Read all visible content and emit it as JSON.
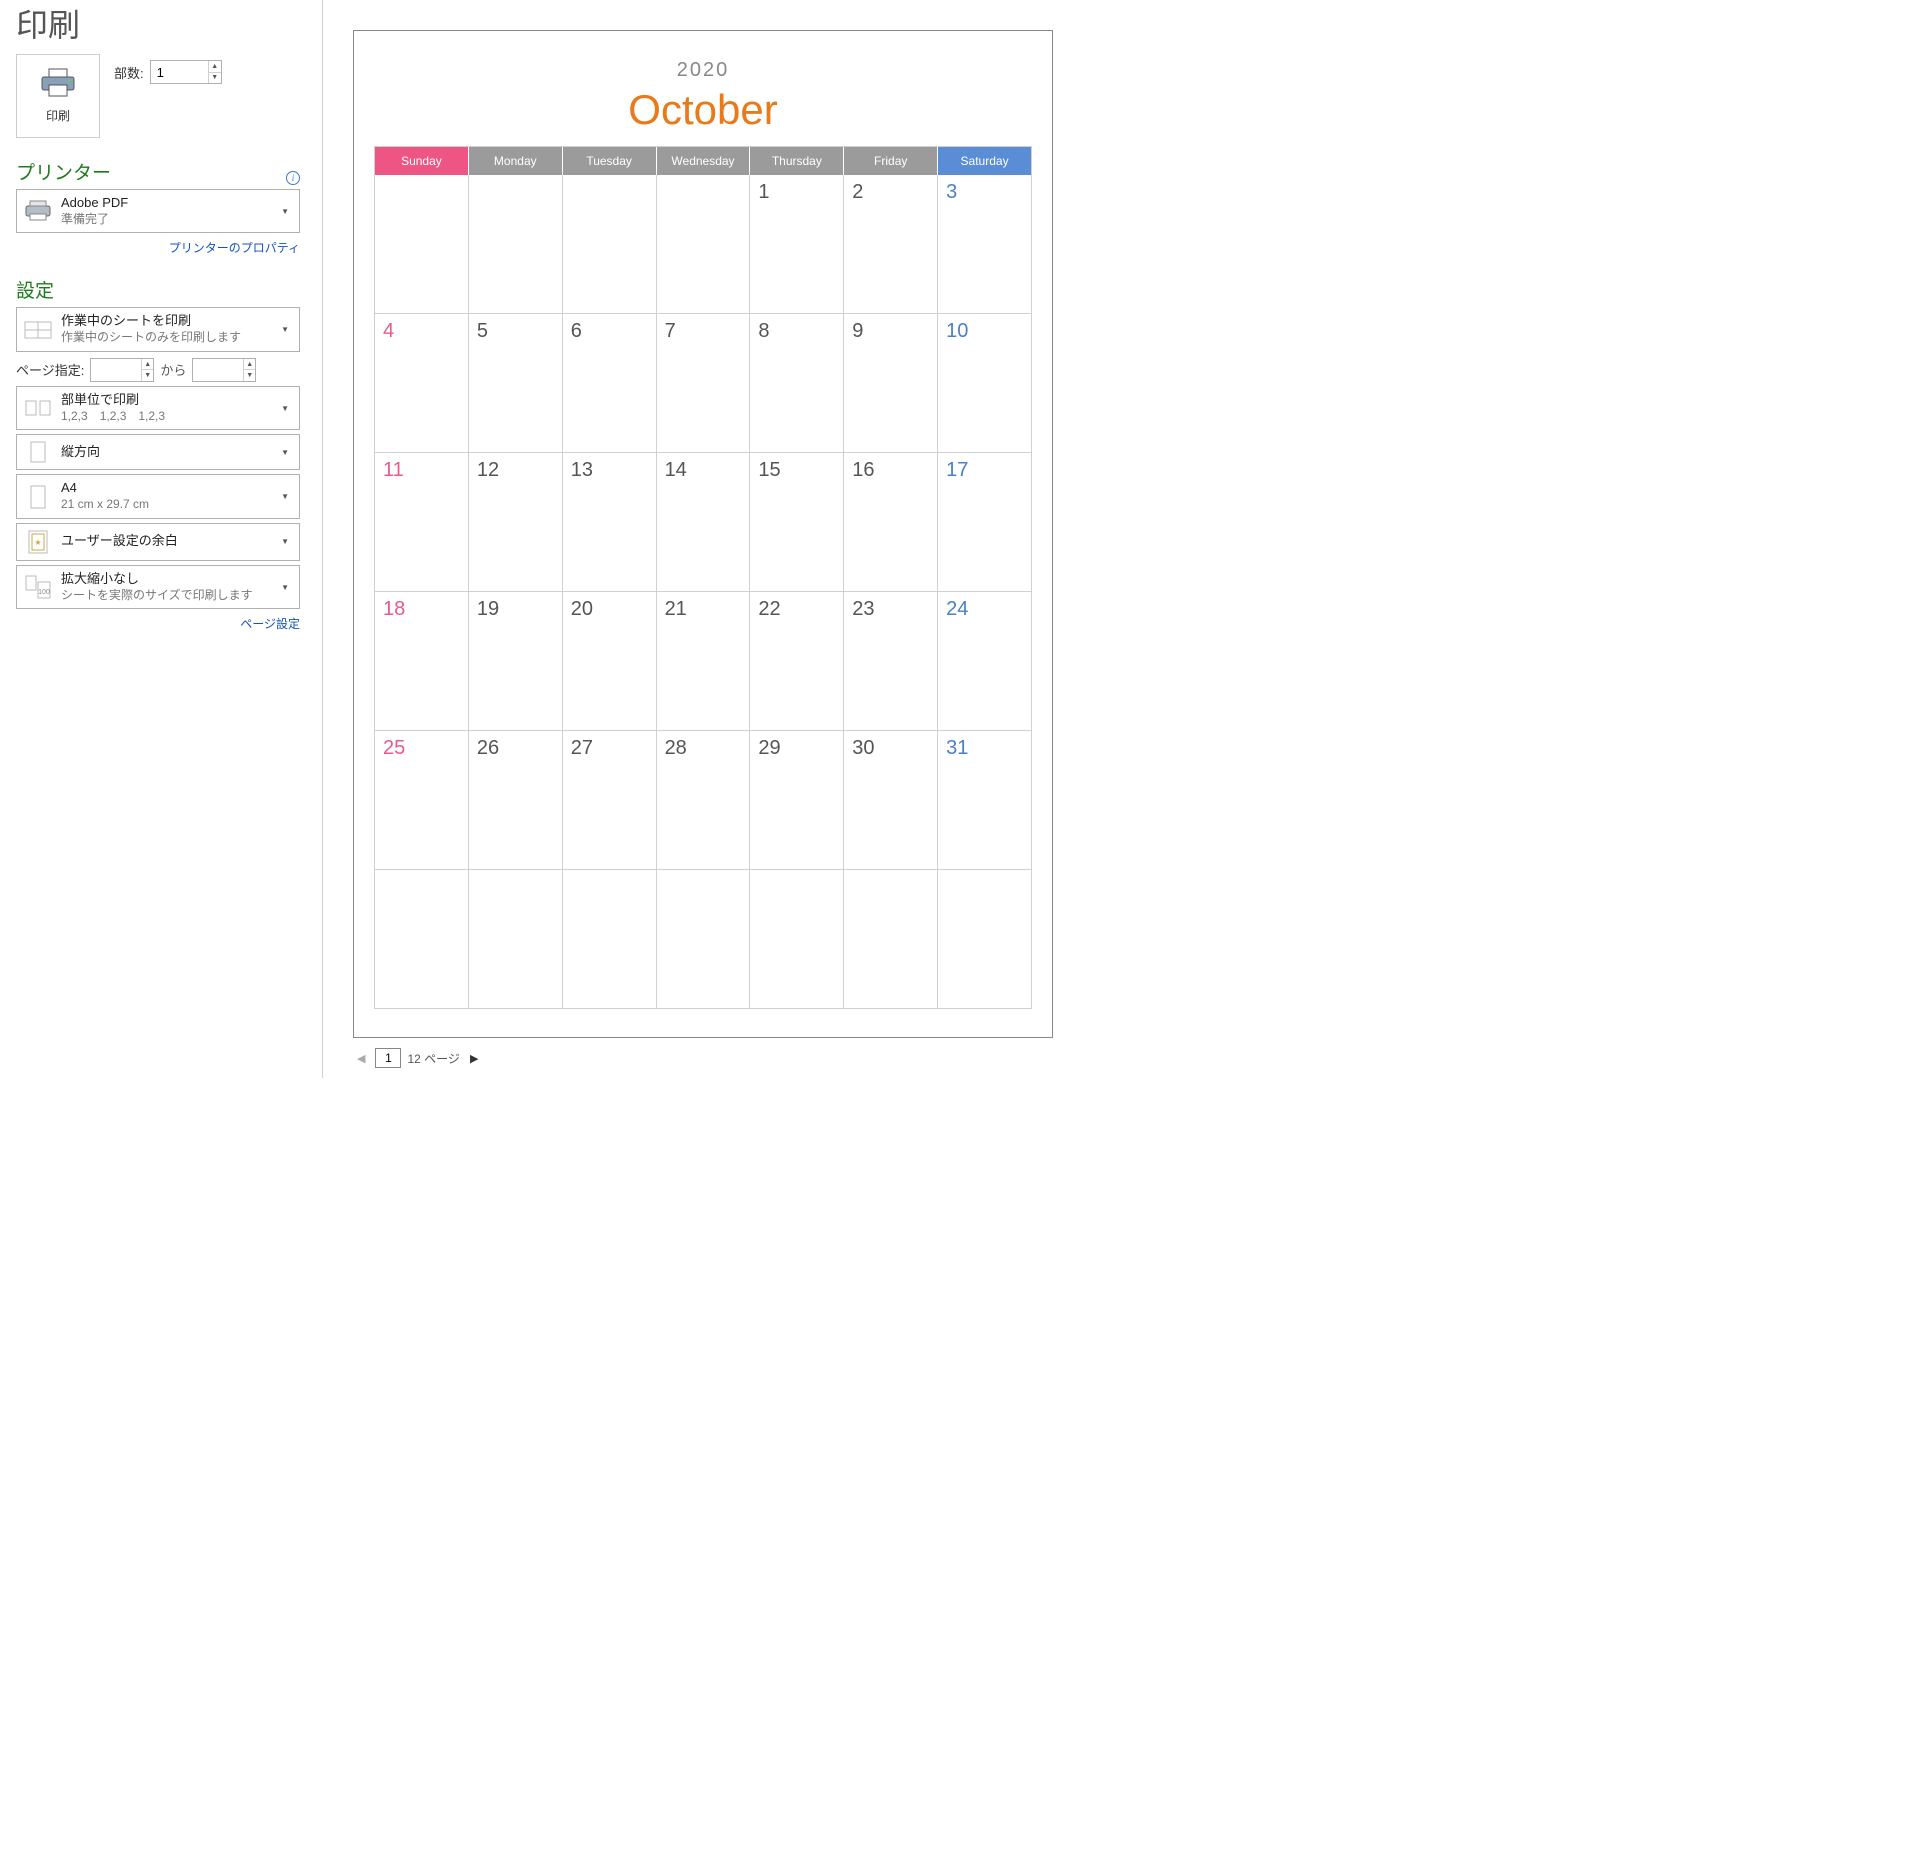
{
  "title": "印刷",
  "print_button_label": "印刷",
  "copies": {
    "label": "部数:",
    "value": "1"
  },
  "printer_section": {
    "title": "プリンター",
    "selected": {
      "name": "Adobe PDF",
      "status": "準備完了"
    },
    "properties_link": "プリンターのプロパティ"
  },
  "settings_section": {
    "title": "設定",
    "print_what": {
      "main": "作業中のシートを印刷",
      "sub": "作業中のシートのみを印刷します"
    },
    "page_range": {
      "label": "ページ指定:",
      "from": "",
      "to": "",
      "sep": "から"
    },
    "collation": {
      "main": "部単位で印刷",
      "sub": "1,2,3　1,2,3　1,2,3"
    },
    "orientation": {
      "main": "縦方向"
    },
    "paper": {
      "main": "A4",
      "sub": "21 cm x 29.7 cm"
    },
    "margins": {
      "main": "ユーザー設定の余白"
    },
    "scaling": {
      "main": "拡大縮小なし",
      "sub": "シートを実際のサイズで印刷します"
    },
    "page_setup_link": "ページ設定"
  },
  "calendar": {
    "year": "2020",
    "month": "October",
    "weekdays": [
      "Sunday",
      "Monday",
      "Tuesday",
      "Wednesday",
      "Thursday",
      "Friday",
      "Saturday"
    ],
    "weeks": [
      [
        "",
        "",
        "",
        "",
        "1",
        "2",
        "3"
      ],
      [
        "4",
        "5",
        "6",
        "7",
        "8",
        "9",
        "10"
      ],
      [
        "11",
        "12",
        "13",
        "14",
        "15",
        "16",
        "17"
      ],
      [
        "18",
        "19",
        "20",
        "21",
        "22",
        "23",
        "24"
      ],
      [
        "25",
        "26",
        "27",
        "28",
        "29",
        "30",
        "31"
      ],
      [
        "",
        "",
        "",
        "",
        "",
        "",
        ""
      ]
    ]
  },
  "pager": {
    "current": "1",
    "total": "12",
    "suffix": "ページ"
  }
}
